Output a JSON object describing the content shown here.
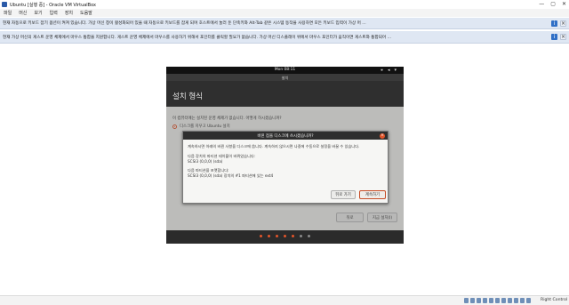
{
  "window": {
    "title": "Ubuntu [실행 중] - Oracle VM VirtualBox",
    "controls": {
      "minimize": "—",
      "maximize": "▢",
      "close": "✕"
    }
  },
  "menubar": {
    "items": [
      "파일",
      "머신",
      "보기",
      "입력",
      "장치",
      "도움말"
    ]
  },
  "notices": [
    {
      "text": "현재 자동으로 키보드 잡기 옵션이 켜져 있습니다. 가상 머신 창이 활성화되어 있을 때 자동으로 키보드를 잡게 되며 호스트에서 눌러 둔 단축키와 Alt-Tab 같은 시스템 동작을 사용하면 모든 키보드 입력이 가상 머 ..."
    },
    {
      "text": "현재 가상 머신의 게스트 운영 체제에서 마우스 통합을 지원합니다. 게스트 운영 체제에서 마우스를 사용하기 위해서 포인터를 클릭할 필요가 없습니다. 가상 머신 디스플레이 위에서 마우스 포인터가 움직이면 게스트와 통합되어 ..."
    }
  ],
  "guest": {
    "topbar": {
      "clock": "Mon 08:11"
    },
    "installer": {
      "window_title": "설치",
      "header": "설치 형식",
      "question": "이 컴퓨터에는 설치된 운영 체제가 없습니다. 어떻게 하시겠습니까?",
      "option": "디스크를 지우고 Ubuntu 설치",
      "back_button": "뒤로",
      "install_button": "지금 설치(I)"
    },
    "dialog": {
      "title": "바뀐 점을 디스크에 쓰시겠습니까?",
      "close_icon": "×",
      "lines": [
        "계속하시면 아래의 바뀐 사항을 디스크에 씁니다. 계속하지 않으시면 나중에 수동으로 설정을 바꿀 수 있습니다.",
        "다음 장치의 파티션 테이블이 바뀌었습니다:",
        "SCSI3 (0,0,0) (sda)",
        "다음 파티션을 포맷합니다:",
        "SCSI3 (0,0,0) (sda) 장치의 #1 파티션에 있는 ext4"
      ],
      "back_button": "뒤로 가기",
      "continue_button": "계속하기"
    },
    "progress": {
      "total": 7,
      "done": 5
    }
  },
  "statusbar": {
    "host_key": "Right Control"
  },
  "colors": {
    "accent": "#e2552a",
    "topbar": "#111111",
    "notice_bg": "#dfe7f3"
  }
}
